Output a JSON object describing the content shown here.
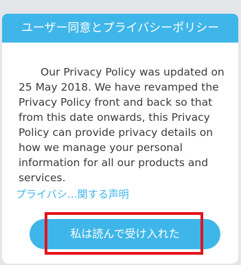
{
  "dialog": {
    "title": "ユーザー同意とプライバシーポリシー",
    "body_text": "Our Privacy Policy was updated on 25 May 2018. We have revamped the Privacy Policy front and back so that from this date onwards, this Privacy Policy can provide privacy details on how we manage your personal information for all our products and services.",
    "policy_link": "プライバシ…関する声明",
    "accept_label": "私は読んで受け入れた"
  },
  "colors": {
    "accent": "#3fb6e9",
    "highlight": "#e4131b"
  }
}
